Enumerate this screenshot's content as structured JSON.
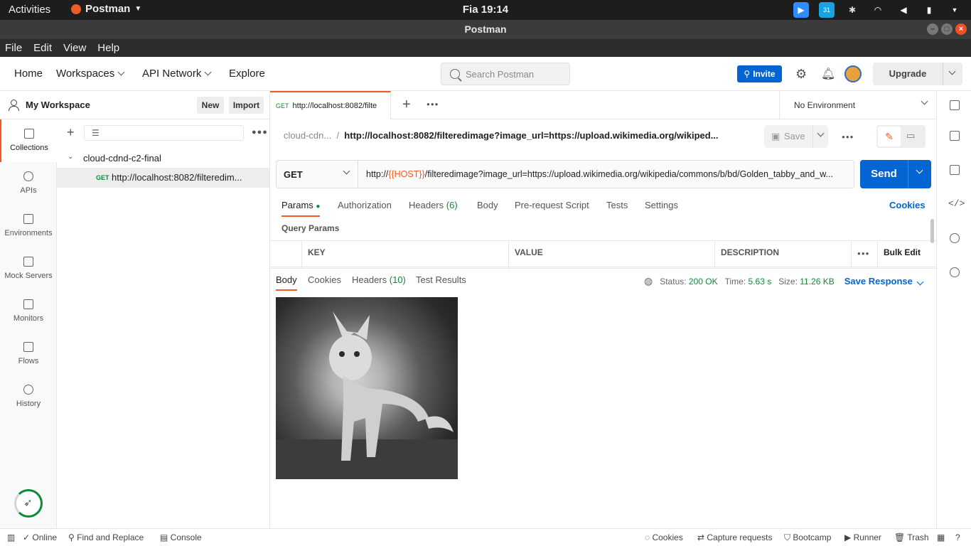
{
  "os_bar": {
    "activities": "Activities",
    "app_name": "Postman",
    "clock": "Fia 19:14",
    "calendar_badge": "31"
  },
  "window": {
    "title": "Postman"
  },
  "menu": [
    "File",
    "Edit",
    "View",
    "Help"
  ],
  "header": {
    "home": "Home",
    "workspaces": "Workspaces",
    "api_network": "API Network",
    "explore": "Explore",
    "search_placeholder": "Search Postman",
    "invite": "Invite",
    "upgrade": "Upgrade"
  },
  "workspace": {
    "name": "My Workspace",
    "new_label": "New",
    "import_label": "Import"
  },
  "rail": [
    {
      "label": "Collections",
      "icon": "collections-icon"
    },
    {
      "label": "APIs",
      "icon": "apis-icon"
    },
    {
      "label": "Environments",
      "icon": "environments-icon"
    },
    {
      "label": "Mock Servers",
      "icon": "mock-servers-icon"
    },
    {
      "label": "Monitors",
      "icon": "monitors-icon"
    },
    {
      "label": "Flows",
      "icon": "flows-icon"
    },
    {
      "label": "History",
      "icon": "history-icon"
    }
  ],
  "sidebar": {
    "collection": "cloud-cdnd-c2-final",
    "request_method": "GET",
    "request_name": "http://localhost:8082/filteredim..."
  },
  "tabs": {
    "active_method": "GET",
    "active_label": "http://localhost:8082/filte",
    "environment": "No Environment"
  },
  "request": {
    "crumb_collection": "cloud-cdn...",
    "crumb_sep": "/",
    "crumb_request": "http://localhost:8082/filteredimage?image_url=https://upload.wikimedia.org/wikiped...",
    "save_label": "Save",
    "method": "GET",
    "url_prefix": "http://",
    "url_var": "{{HOST}}",
    "url_rest": "/filteredimage?image_url=https://upload.wikimedia.org/wikipedia/commons/b/bd/Golden_tabby_and_w...",
    "send_label": "Send"
  },
  "request_tabs": {
    "params": "Params",
    "authorization": "Authorization",
    "headers": "Headers",
    "headers_count": "(6)",
    "body": "Body",
    "prerequest": "Pre-request Script",
    "tests": "Tests",
    "settings": "Settings",
    "cookies": "Cookies"
  },
  "params": {
    "section_title": "Query Params",
    "col_key": "KEY",
    "col_value": "VALUE",
    "col_description": "DESCRIPTION",
    "bulk_edit": "Bulk Edit"
  },
  "response": {
    "tab_body": "Body",
    "tab_cookies": "Cookies",
    "tab_headers": "Headers",
    "headers_count": "(10)",
    "tab_test_results": "Test Results",
    "status_label": "Status:",
    "status_value": "200 OK",
    "time_label": "Time:",
    "time_value": "5.63 s",
    "size_label": "Size:",
    "size_value": "11.26 KB",
    "save_response": "Save Response"
  },
  "statusbar": {
    "online": "Online",
    "find_replace": "Find and Replace",
    "console": "Console",
    "cookies": "Cookies",
    "capture": "Capture requests",
    "bootcamp": "Bootcamp",
    "runner": "Runner",
    "trash": "Trash"
  },
  "colors": {
    "accent": "#ef5b25",
    "primary": "#0265d2",
    "success": "#0b8a3a"
  }
}
